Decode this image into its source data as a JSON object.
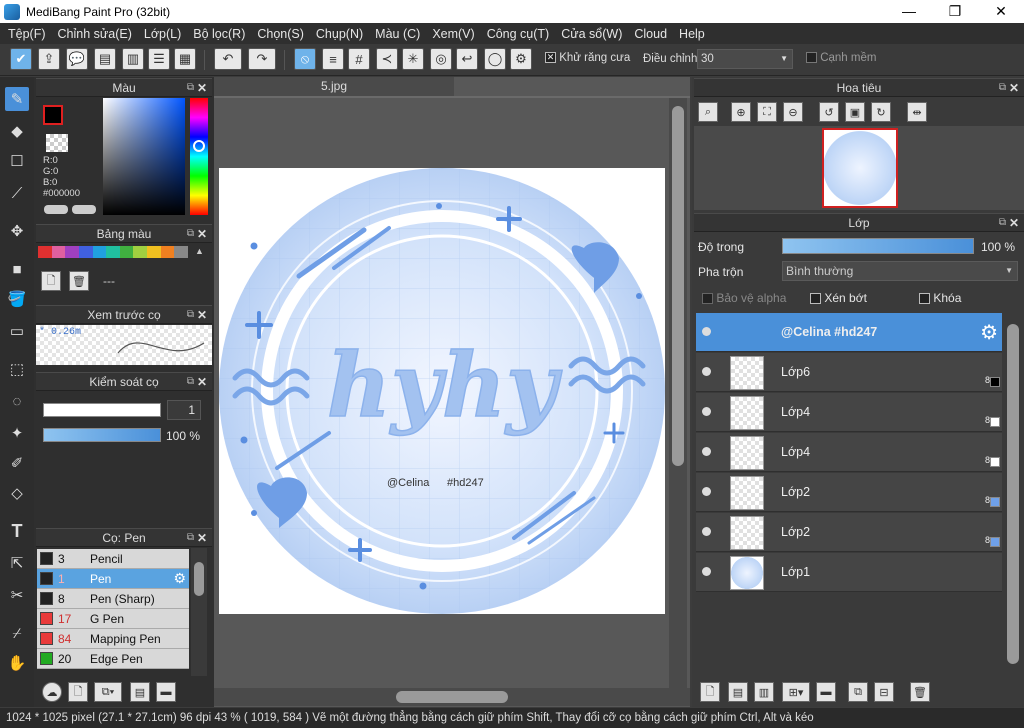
{
  "window": {
    "title": "MediBang Paint Pro (32bit)",
    "minimize": "—",
    "maximize": "❐",
    "close": "✕"
  },
  "menu": [
    "Tệp(F)",
    "Chỉnh sửa(E)",
    "Lớp(L)",
    "Bộ lọc(R)",
    "Chọn(S)",
    "Chụp(N)",
    "Màu (C)",
    "Xem(V)",
    "Công cụ(T)",
    "Cửa sổ(W)",
    "Cloud",
    "Help"
  ],
  "toolbar": {
    "antialias_label": "Khử răng cưa",
    "adjust_label": "Điều chỉnh",
    "adjust_value": "30",
    "soft_edge_label": "Cạnh mềm"
  },
  "color_panel": {
    "title": "Màu",
    "r": "R:0",
    "g": "G:0",
    "b": "B:0",
    "hex": "#000000"
  },
  "palette_panel": {
    "title": "Bảng màu",
    "value": "---"
  },
  "brush_preview_panel": {
    "title": "Xem trước cọ",
    "size": "* 0.26m"
  },
  "brush_control_panel": {
    "title": "Kiểm soát cọ",
    "size": "1",
    "opacity": "100 %"
  },
  "brush_panel": {
    "title": "Cọ: Pen",
    "items": [
      {
        "num": "3",
        "name": "Pencil",
        "color": "#222222",
        "selected": false
      },
      {
        "num": "1",
        "name": "Pen",
        "color": "#222222",
        "selected": true
      },
      {
        "num": "8",
        "name": "Pen (Sharp)",
        "color": "#222222",
        "selected": false
      },
      {
        "num": "17",
        "name": "G Pen",
        "color": "#e83a3a",
        "selected": false
      },
      {
        "num": "84",
        "name": "Mapping Pen",
        "color": "#e83a3a",
        "selected": false
      },
      {
        "num": "20",
        "name": "Edge Pen",
        "color": "#22aa22",
        "selected": false
      }
    ]
  },
  "document": {
    "tab": "5.jpg",
    "art_text": "hyhy",
    "signature": "@Celina",
    "tag": "#hd247"
  },
  "navigator_panel": {
    "title": "Hoa tiêu"
  },
  "layer_panel": {
    "title": "Lớp",
    "opacity_label": "Độ trong",
    "opacity_value": "100 %",
    "blend_label": "Pha trộn",
    "blend_value": "Bình thường",
    "protect_alpha": "Bảo vệ alpha",
    "clipping": "Xén bớt",
    "lock": "Khóa",
    "layers": [
      {
        "name": "@Celina      #hd247",
        "opacity": "",
        "swatch": "",
        "selected": true
      },
      {
        "name": "Lớp6",
        "opacity": "8",
        "swatch": "#000000",
        "selected": false
      },
      {
        "name": "Lớp4",
        "opacity": "8",
        "swatch": "#ffffff",
        "selected": false
      },
      {
        "name": "Lớp4",
        "opacity": "8",
        "swatch": "#ffffff",
        "selected": false
      },
      {
        "name": "Lớp2",
        "opacity": "8",
        "swatch": "#6fa0e8",
        "selected": false
      },
      {
        "name": "Lớp2",
        "opacity": "8",
        "swatch": "#6fa0e8",
        "selected": false
      },
      {
        "name": "Lớp1",
        "opacity": "",
        "swatch": "",
        "selected": false
      }
    ]
  },
  "status": "1024 * 1025 pixel   (27.1 * 27.1cm)   96 dpi   43 %   ( 1019, 584 )   Vẽ một đường thẳng bằng cách giữ phím Shift, Thay đổi cỡ cọ bằng cách giữ phím Ctrl, Alt và kéo",
  "colors": {
    "accent": "#4a90d9",
    "art_bg": "#bcd4f6",
    "art_stroke": "#7aa6e8"
  }
}
